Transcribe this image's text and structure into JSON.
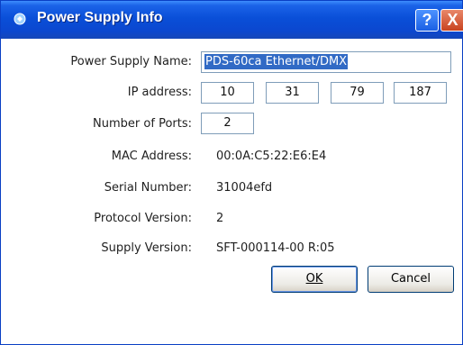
{
  "window": {
    "title": "Power Supply Info",
    "help_label": "?",
    "close_label": "X"
  },
  "form": {
    "name_label": "Power Supply Name:",
    "name_value": "PDS-60ca Ethernet/DMX",
    "ip_label": "IP address:",
    "ip_octets": [
      "10",
      "31",
      "79",
      "187"
    ],
    "ports_label": "Number of Ports:",
    "ports_value": "2",
    "mac_label": "MAC Address:",
    "mac_value": "00:0A:C5:22:E6:E4",
    "serial_label": "Serial Number:",
    "serial_value": "31004efd",
    "protocol_label": "Protocol Version:",
    "protocol_value": "2",
    "supply_label": "Supply Version:",
    "supply_value": "SFT-000114-00 R:05"
  },
  "buttons": {
    "ok_label": "OK",
    "cancel_label": "Cancel"
  },
  "colors": {
    "titlebar": "#0a4fd8",
    "selection": "#316ac5",
    "close": "#c8431f"
  }
}
